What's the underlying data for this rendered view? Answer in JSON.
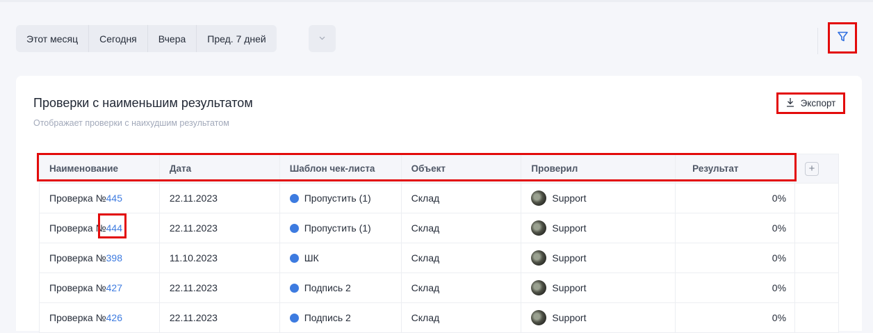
{
  "period": {
    "options": [
      "Этот месяц",
      "Сегодня",
      "Вчера",
      "Пред. 7 дней"
    ],
    "dropdown_icon": "chevron-down-icon"
  },
  "filter": {
    "icon": "filter-icon",
    "color": "#2f6fe0"
  },
  "card": {
    "title": "Проверки с наименьшим результатом",
    "subtitle": "Отображает проверки с наихудшим результатом",
    "export": {
      "label": "Экспорт",
      "icon": "download-icon"
    }
  },
  "table": {
    "columns": [
      "Наименование",
      "Дата",
      "Шаблон чек-листа",
      "Объект",
      "Проверил",
      "Результат"
    ],
    "add_column_label": "+",
    "rows": [
      {
        "name_prefix": "Проверка №",
        "number": "445",
        "date": "22.11.2023",
        "template": "Пропустить (1)",
        "object": "Склад",
        "checker": "Support",
        "result": "0%"
      },
      {
        "name_prefix": "Проверка №",
        "number": "444",
        "date": "22.11.2023",
        "template": "Пропустить (1)",
        "object": "Склад",
        "checker": "Support",
        "result": "0%"
      },
      {
        "name_prefix": "Проверка №",
        "number": "398",
        "date": "11.10.2023",
        "template": "ШК",
        "object": "Склад",
        "checker": "Support",
        "result": "0%"
      },
      {
        "name_prefix": "Проверка №",
        "number": "427",
        "date": "22.11.2023",
        "template": "Подпись 2",
        "object": "Склад",
        "checker": "Support",
        "result": "0%"
      },
      {
        "name_prefix": "Проверка №",
        "number": "426",
        "date": "22.11.2023",
        "template": "Подпись 2",
        "object": "Склад",
        "checker": "Support",
        "result": "0%"
      }
    ]
  },
  "colors": {
    "accent": "#3d7be0",
    "result_bad": "#e0473f",
    "highlight": "#e30b0b"
  }
}
